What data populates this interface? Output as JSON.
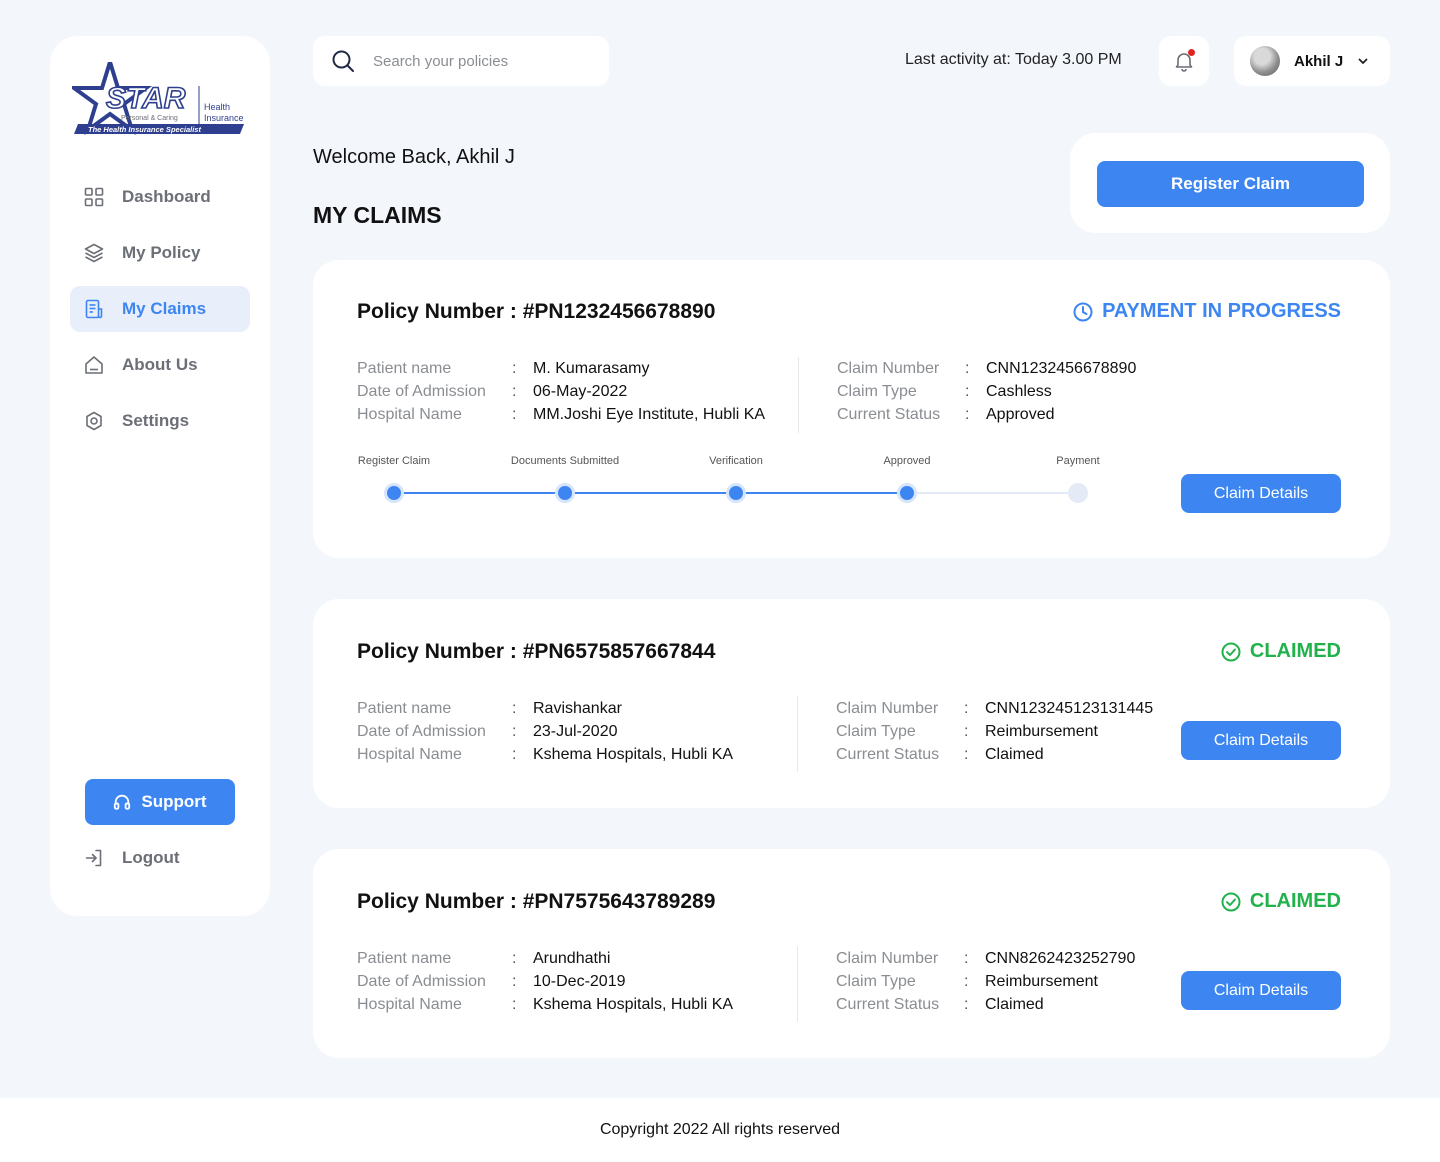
{
  "brand": {
    "logo_word": "STAR",
    "logo_tagline_small": "Personal & Caring",
    "logo_health": "Health",
    "logo_insurance": "Insurance",
    "logo_strap": "The Health Insurance Specialist",
    "color": "#2e3f8f"
  },
  "sidebar": {
    "items": [
      {
        "label": "Dashboard",
        "icon": "grid-icon"
      },
      {
        "label": "My Policy",
        "icon": "layers-icon"
      },
      {
        "label": "My Claims",
        "icon": "document-icon",
        "active": true
      },
      {
        "label": "About Us",
        "icon": "home-icon"
      },
      {
        "label": "Settings",
        "icon": "gear-icon"
      }
    ],
    "support_label": "Support",
    "logout_label": "Logout"
  },
  "header": {
    "search_placeholder": "Search your policies",
    "last_activity": "Last activity at: Today 3.00 PM",
    "user_name": "Akhil J"
  },
  "main": {
    "welcome": "Welcome Back, Akhil J",
    "title": "MY CLAIMS",
    "register_label": "Register Claim"
  },
  "labels": {
    "patient": "Patient name",
    "admission": "Date of Admission",
    "hospital": "Hospital Name",
    "claim_number": "Claim Number",
    "claim_type": "Claim Type",
    "current_status": "Current Status",
    "colon": ":",
    "details_button": "Claim Details"
  },
  "claims": [
    {
      "policy": "Policy Number : #PN1232456678890",
      "status": "PAYMENT IN PROGRESS",
      "patient": "M. Kumarasamy",
      "admission": "06-May-2022",
      "hospital": "MM.Joshi Eye Institute, Hubli KA",
      "claim_number": "CNN1232456678890",
      "claim_type": "Cashless",
      "current_status": "Approved",
      "steps": [
        "Register Claim",
        "Documents Submitted",
        "Verification",
        "Approved",
        "Payment"
      ],
      "steps_completed": 4
    },
    {
      "policy": "Policy Number : #PN6575857667844",
      "status": "CLAIMED",
      "patient": "Ravishankar",
      "admission": "23-Jul-2020",
      "hospital": "Kshema Hospitals, Hubli KA",
      "claim_number": "CNN123245123131445",
      "claim_type": "Reimbursement",
      "current_status": "Claimed"
    },
    {
      "policy": "Policy Number : #PN7575643789289",
      "status": "CLAIMED",
      "patient": "Arundhathi",
      "admission": "10-Dec-2019",
      "hospital": "Kshema Hospitals, Hubli KA",
      "claim_number": "CNN8262423252790",
      "claim_type": "Reimbursement",
      "current_status": "Claimed"
    }
  ],
  "footer": {
    "text": "Copyright 2022 All rights reserved"
  },
  "colors": {
    "accent": "#3d86f2",
    "claimed": "#22b24c",
    "background": "#f3f7fc"
  }
}
